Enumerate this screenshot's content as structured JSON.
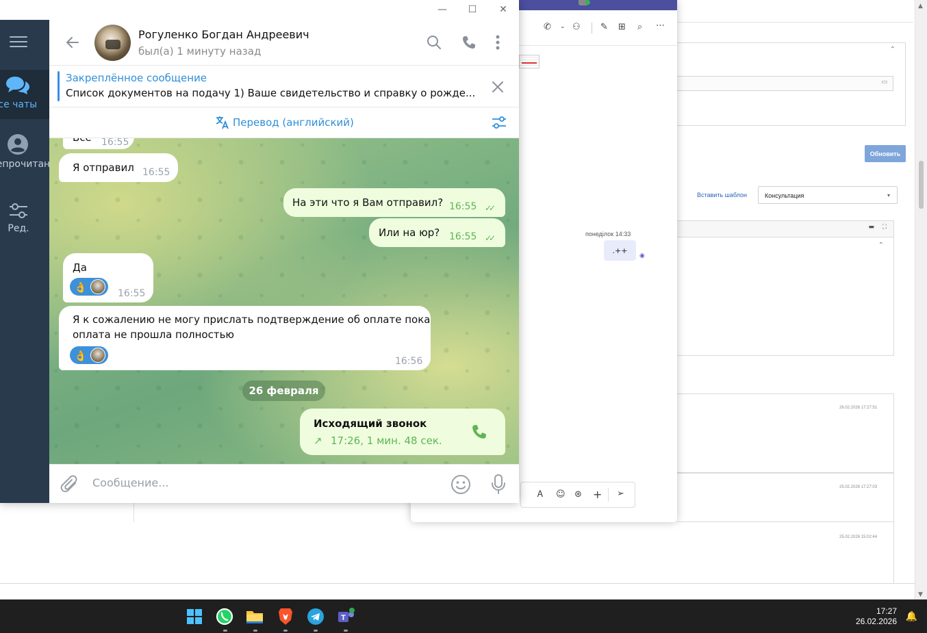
{
  "telegram": {
    "sidebar": {
      "folders": [
        {
          "label": "Все чаты",
          "icon": "chats-icon"
        },
        {
          "label": "Непрочитано",
          "icon": "user-icon"
        },
        {
          "label": "Ред.",
          "icon": "sliders-icon"
        }
      ]
    },
    "header": {
      "name": "Рогуленко Богдан Андреевич",
      "status": "был(а) 1 минуту назад"
    },
    "pinned": {
      "title": "Закреплённое сообщение",
      "text": "Список документов на подачу  1) Ваше свидетельство и справку о рожде..."
    },
    "translate": {
      "label": "Перевод (английский)"
    },
    "messages": {
      "partial": {
        "text": "Все",
        "time": "16:55"
      },
      "m1": {
        "text": "Я отправил",
        "time": "16:55"
      },
      "m2": {
        "text": "На эти что я Вам отправил?",
        "time": "16:55"
      },
      "m3": {
        "text": "Или на юр?",
        "time": "16:55"
      },
      "m4": {
        "text": "Да",
        "time": "16:55",
        "reaction": "👌"
      },
      "m5": {
        "line1": "Я к сожалению не могу прислать подтверждение об оплате пока",
        "line2": "оплата не прошла полностью",
        "time": "16:56",
        "reaction": "👌"
      },
      "date": "26 февраля",
      "call": {
        "title": "Исходящий звонок",
        "detail": "17:26, 1 мин. 48 сек."
      }
    },
    "composer": {
      "placeholder": "Сообщение..."
    }
  },
  "teams": {
    "timestamp": "понеділок 14:33",
    "bubble": ".++"
  },
  "crm": {
    "update_button": "Обновить",
    "insert_template": "Вставить шаблон",
    "template_select": "Консультация",
    "dates": [
      "26.02.2026 17:27:51",
      "25.02.2026 17:27:03",
      "25.02.2026 15:02:44"
    ]
  },
  "taskbar": {
    "time": "17:27",
    "date": "26.02.2026",
    "apps": [
      "windows-start-icon",
      "whatsapp-icon",
      "file-explorer-icon",
      "brave-icon",
      "telegram-icon",
      "teams-icon"
    ]
  },
  "colors": {
    "accent": "#2f8fd8",
    "sidebar": "#2a3a4d",
    "outgoing": "#effdde",
    "read_check": "#5fb556"
  }
}
